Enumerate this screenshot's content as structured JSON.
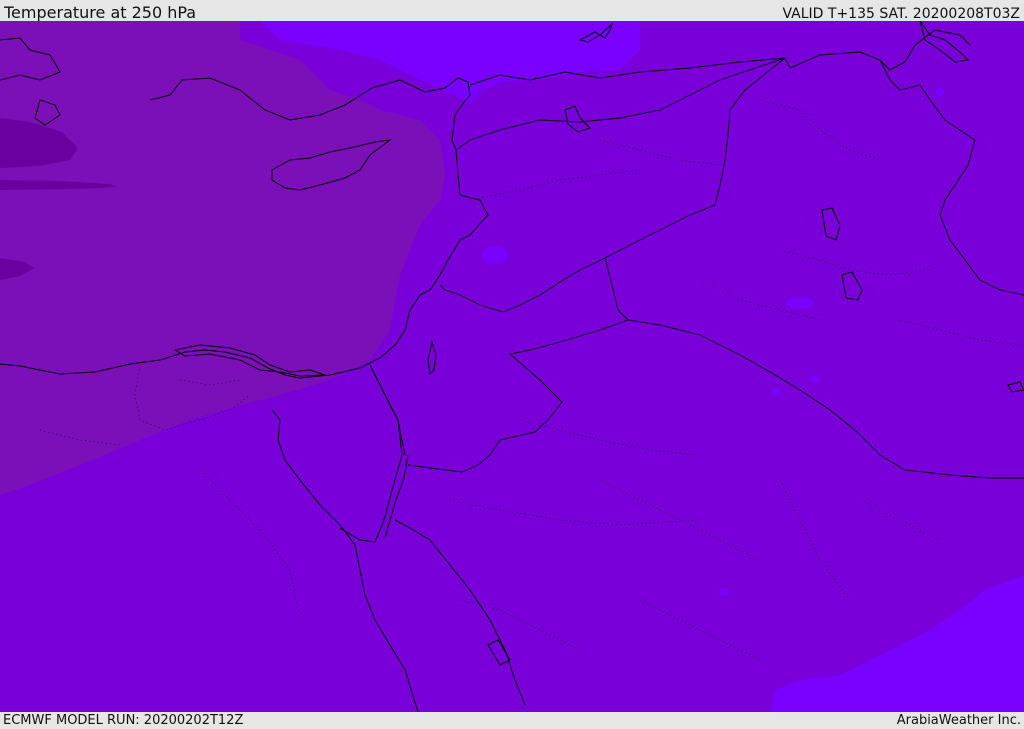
{
  "header": {
    "title": "Temperature at 250 hPa",
    "valid": "VALID T+135 SAT. 20200208T03Z"
  },
  "footer": {
    "model_run": "ECMWF MODEL RUN: 20200202T12Z",
    "credit": "ArabiaWeather Inc."
  },
  "map": {
    "field": "temperature",
    "level": "250 hPa",
    "colors": {
      "base": "#7900d9",
      "warmer": "#7a00ff",
      "cooler": "#7c10b8",
      "coldest": "#6a009f",
      "coast": "#000000"
    }
  }
}
